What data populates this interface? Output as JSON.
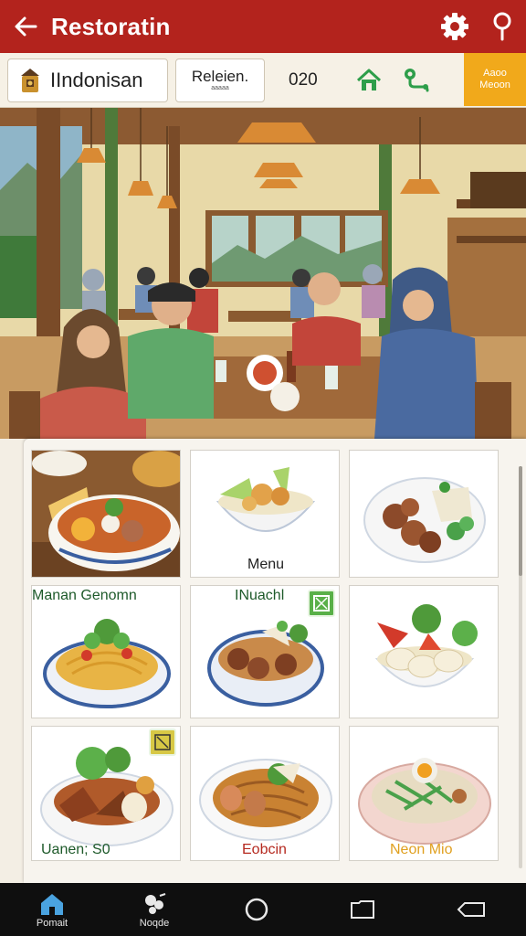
{
  "appbar": {
    "title": "Restoratin",
    "back_icon": "arrow-left-icon",
    "settings_icon": "gear-icon",
    "location_icon": "location-pin-icon",
    "background": "#b3231d"
  },
  "chips": {
    "language": "IIndonisan",
    "select_main": "Releien.",
    "select_sub": "aaaaa",
    "count": "020",
    "home_icon": "home-icon",
    "map_icon": "map-route-icon",
    "promo_line1": "Aaoo",
    "promo_line2": "Meoon",
    "promo_color": "#f1a91b"
  },
  "hero": {
    "description_icon": "restaurant-illustration"
  },
  "menu": {
    "cards": [
      {
        "label": "",
        "dish": "soto-soup"
      },
      {
        "label": "Menu",
        "dish": "fried-chicken-bowl"
      },
      {
        "label": "",
        "dish": "satay-plate"
      },
      {
        "label": "",
        "dish": "mie-goreng"
      },
      {
        "label": "",
        "dish": "meatball-rice-bowl"
      },
      {
        "label": "",
        "dish": "gado-gado-salad"
      },
      {
        "label": "",
        "dish": "semur-plate"
      },
      {
        "label": "",
        "dish": "fried-noodle-plate"
      },
      {
        "label": "",
        "dish": "nasi-campur-bowl"
      }
    ],
    "row_labels": {
      "row2_left": "Manan Genomn",
      "row2_mid": "INuachl",
      "row4_left": "Uanen; S0",
      "row4_mid": "Eobcin",
      "row4_right": "Neon Mio"
    }
  },
  "navbar": {
    "items": [
      {
        "label": "Pomait",
        "icon": "home-icon"
      },
      {
        "label": "Noqde",
        "icon": "ingredients-icon"
      },
      {
        "label": "",
        "icon": "circle-home-icon"
      },
      {
        "label": "",
        "icon": "square-recents-icon"
      },
      {
        "label": "",
        "icon": "back-gesture-icon"
      }
    ]
  }
}
